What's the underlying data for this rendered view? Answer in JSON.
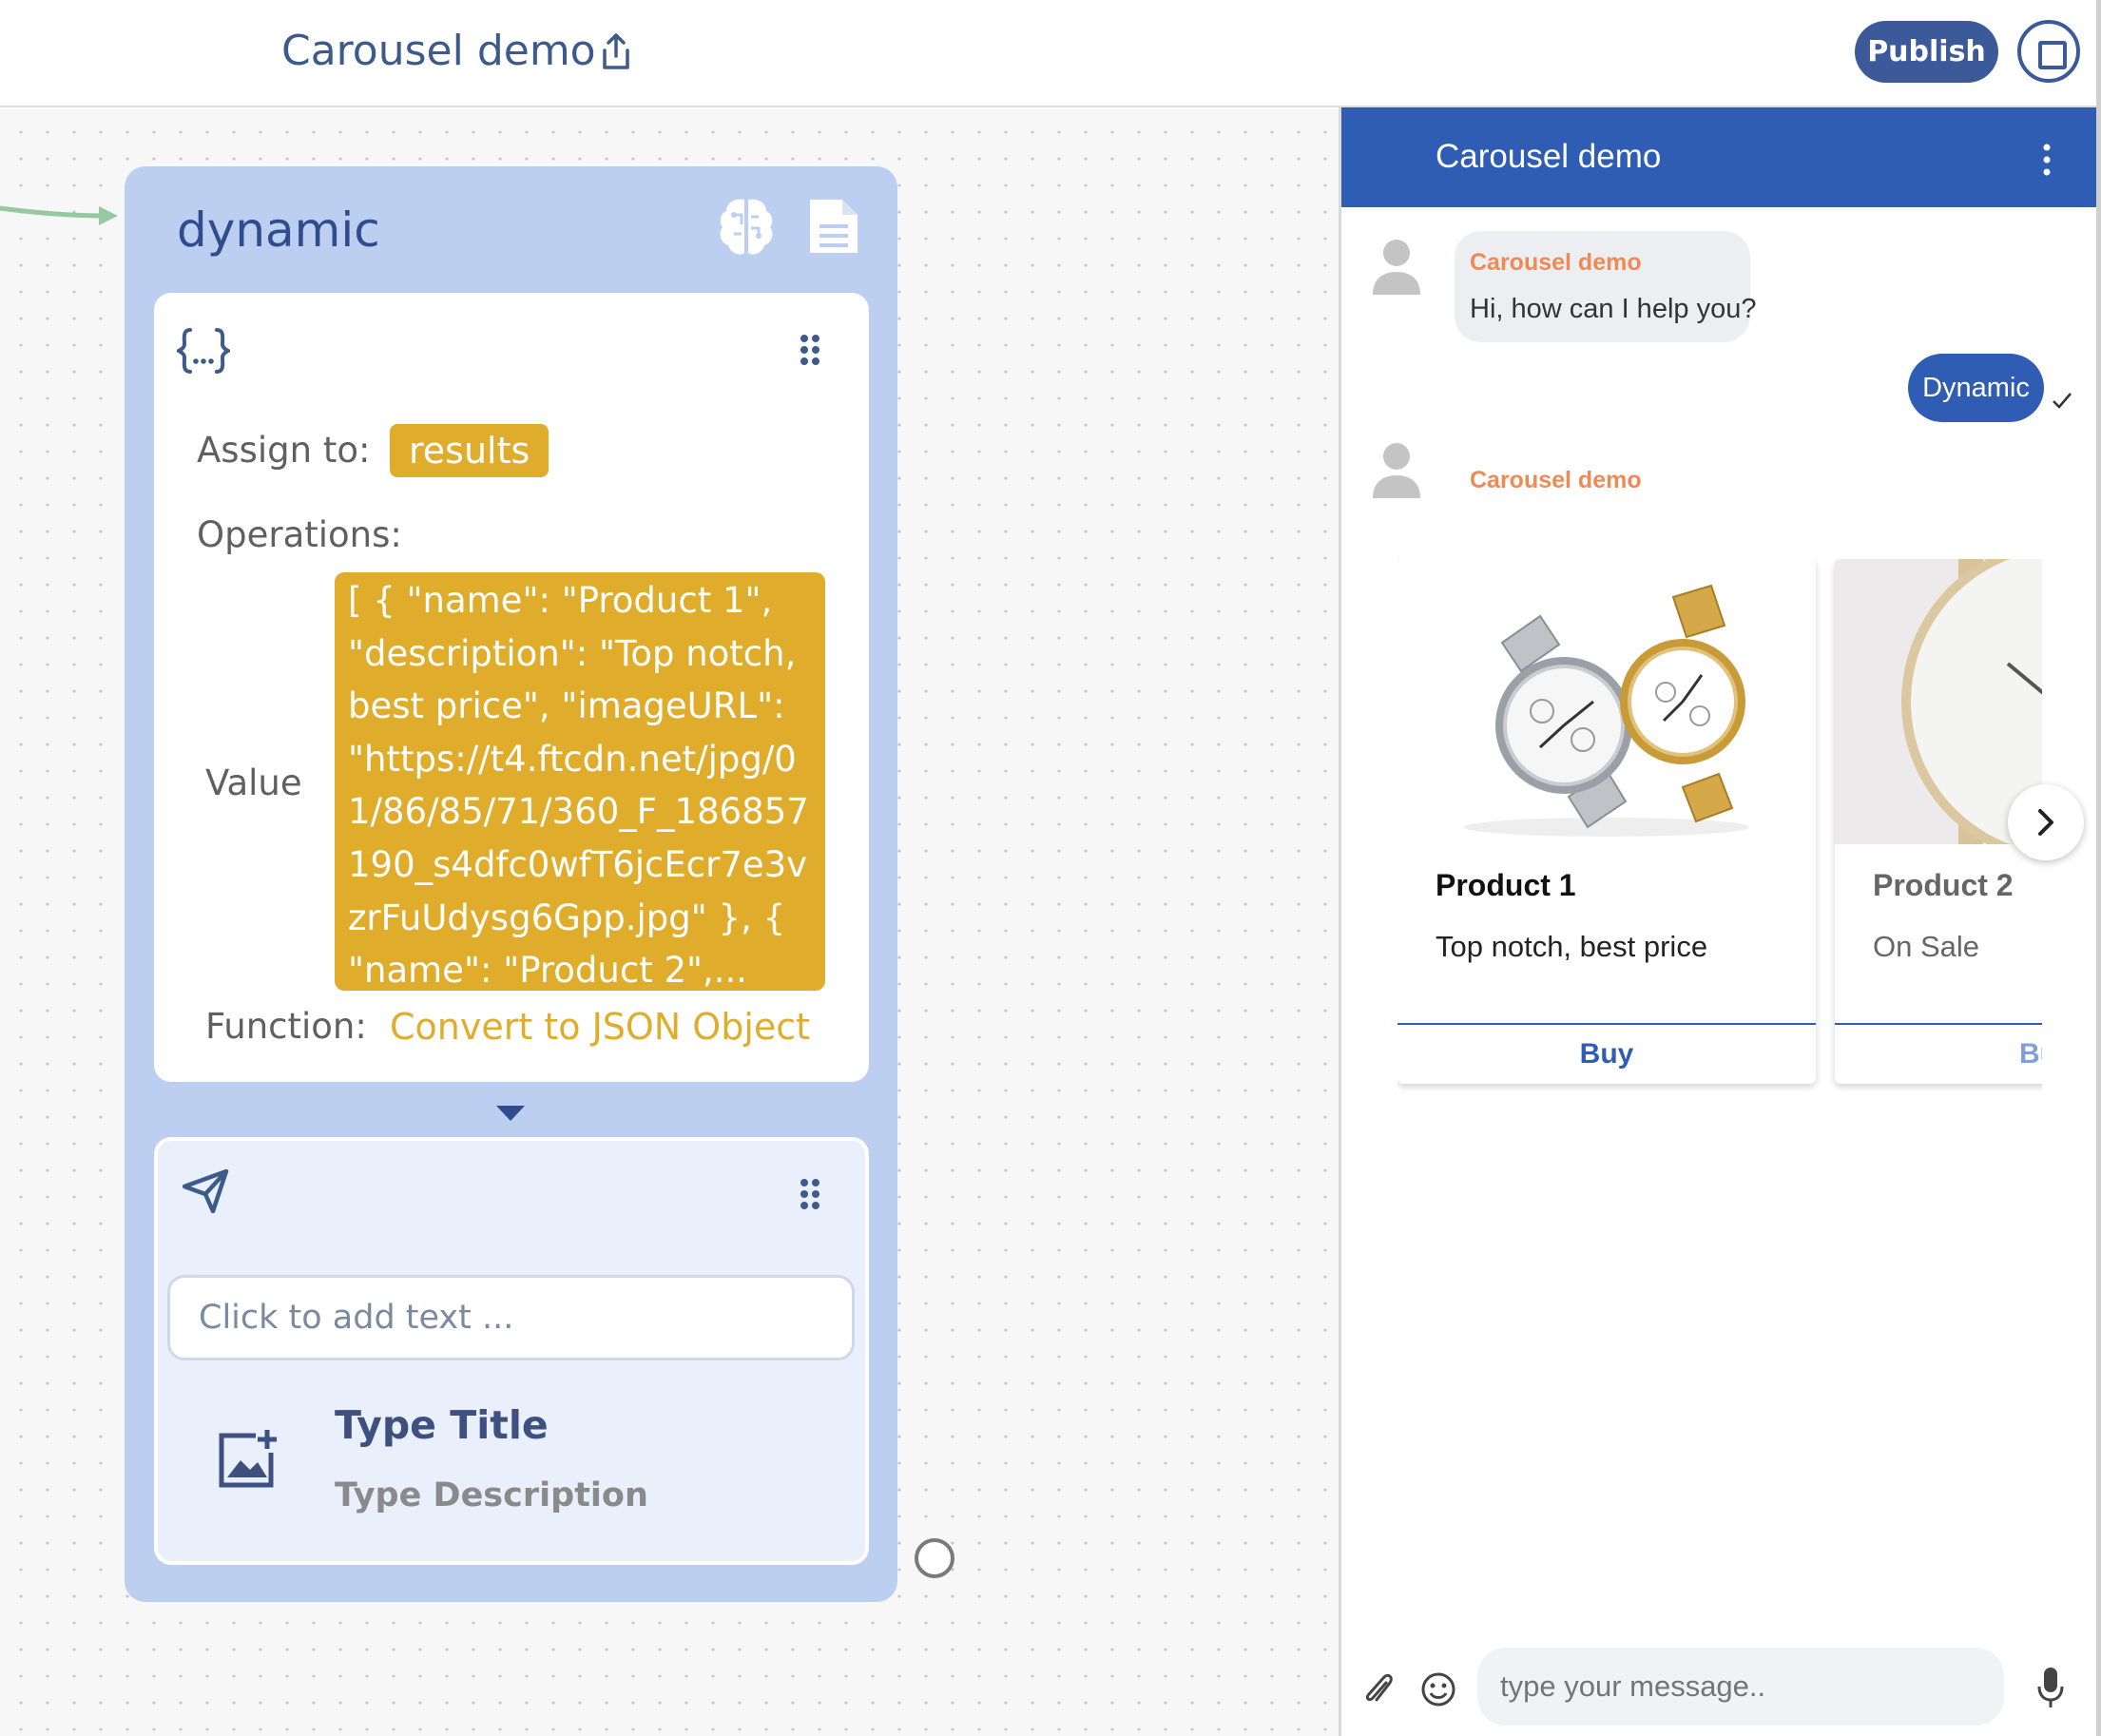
{
  "header": {
    "project_title": "Carousel demo",
    "publish_label": "Publish"
  },
  "node": {
    "title": "dynamic",
    "assign_label": "Assign to:",
    "assign_variable": "results",
    "operations_label": "Operations:",
    "value_label": "Value",
    "value_text": "[ { \"name\": \"Product 1\", \"description\": \"Top notch, best price\", \"imageURL\": \"https://t4.ftcdn.net/jpg/01/86/85/71/360_F_186857190_s4dfc0wfT6jcEcr7e3vzrFuUdysg6Gpp.jpg\" }, { \"name\": \"Product 2\",...",
    "function_label": "Function:",
    "function_value": "Convert to JSON Object",
    "text_placeholder": "Click to add text ...",
    "card_title": "Type Title",
    "card_description": "Type Description"
  },
  "chat": {
    "title": "Carousel demo",
    "bot_name": "Carousel demo",
    "bot_message": "Hi, how can I help you?",
    "user_message": "Dynamic",
    "input_placeholder": "type your message..",
    "carousel": [
      {
        "name": "Product 1",
        "description": "Top notch, best price",
        "button": "Buy"
      },
      {
        "name": "Product 2",
        "description": "On Sale",
        "button": "Buy"
      }
    ]
  },
  "colors": {
    "accent": "#2f5db3",
    "node_bg": "#bccff0",
    "highlight": "#e0ac2b",
    "bot_name": "#ee8a56",
    "publish_bg": "#3c5a9a"
  },
  "icons": [
    "share-icon",
    "stop-icon",
    "brain-icon",
    "document-icon",
    "braces-icon",
    "drag-handle-icon",
    "send-icon",
    "image-add-icon",
    "more-vertical-icon",
    "avatar-icon",
    "check-icon",
    "chevron-right-icon",
    "attach-icon",
    "emoji-icon",
    "mic-icon"
  ]
}
